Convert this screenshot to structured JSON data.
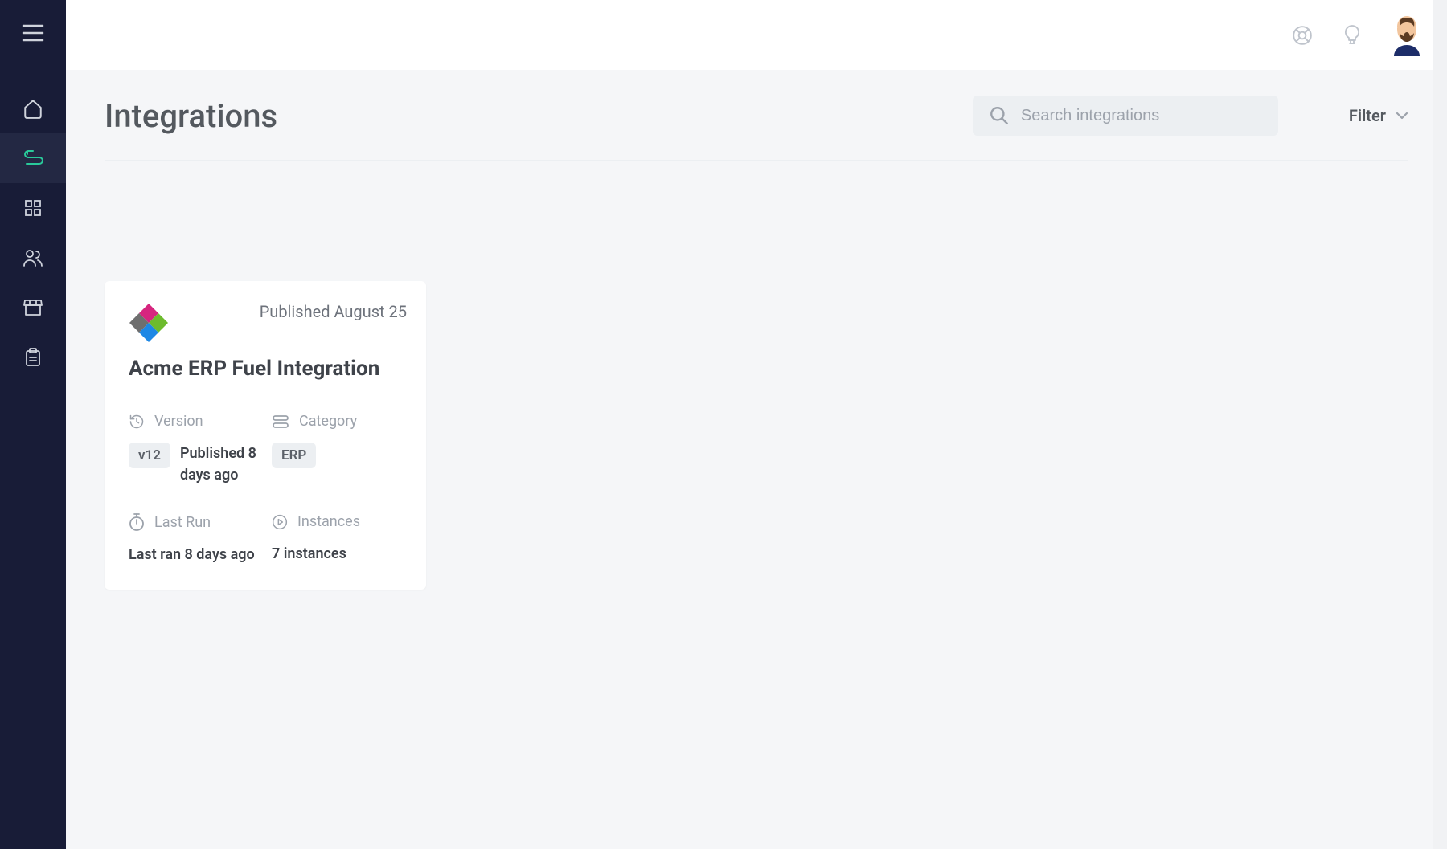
{
  "header": {
    "title": "Integrations",
    "search_placeholder": "Search integrations",
    "filter_label": "Filter"
  },
  "card": {
    "published_date": "Published August 25",
    "title": "Acme ERP Fuel Integration",
    "version_label": "Version",
    "version_badge": "v12",
    "version_detail": "Published 8 days ago",
    "category_label": "Category",
    "category_badge": "ERP",
    "lastrun_label": "Last Run",
    "lastrun_value": "Last ran 8 days ago",
    "instances_label": "Instances",
    "instances_value": "7 instances"
  }
}
